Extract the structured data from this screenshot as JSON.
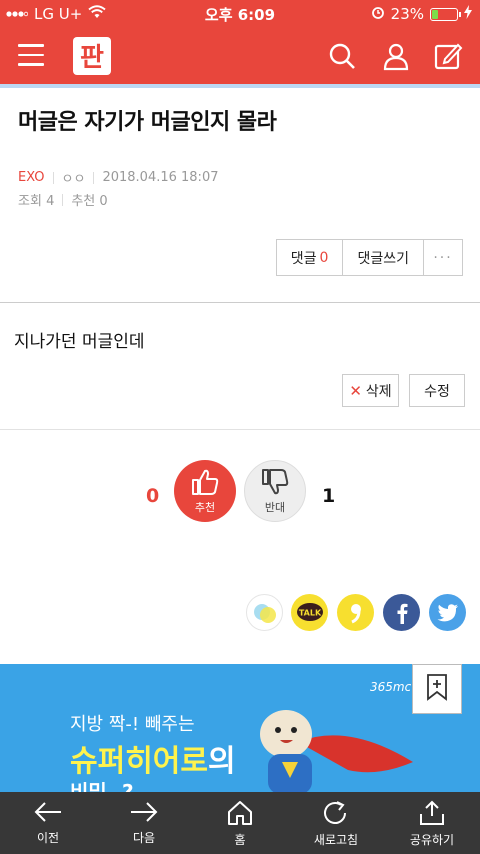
{
  "status_bar": {
    "carrier": "LG U+",
    "time": "오후 6:09",
    "battery": "23%",
    "battery_level": 0.23
  },
  "colors": {
    "brand": "#e8463c",
    "link_blue": "#3aa3e6",
    "toolbar": "#373737"
  },
  "header": {
    "icons": [
      "menu-icon",
      "pann-logo",
      "search-icon",
      "user-icon",
      "write-icon"
    ],
    "logo_text": "판"
  },
  "article": {
    "title": "머글은 자기가 머글인지 몰라",
    "author": "EXO",
    "nickname": "ㅇㅇ",
    "date": "2018.04.16 18:07",
    "views_label": "조회",
    "views": "4",
    "recommend_label": "추천",
    "recommend": "0"
  },
  "actions": {
    "comment_label": "댓글",
    "comment_count": "0",
    "write_comment": "댓글쓰기",
    "more": "···"
  },
  "comment": {
    "text": "지나가던 머글인데",
    "delete_label": "삭제",
    "edit_label": "수정"
  },
  "votes": {
    "up_count": "0",
    "up_label": "추천",
    "down_count": "1",
    "down_label": "반대"
  },
  "share": {
    "icons": [
      "chat-bubbles-icon",
      "kakaotalk-icon",
      "kakaostory-icon",
      "facebook-icon",
      "twitter-icon"
    ],
    "kakao_label": "TALK"
  },
  "banner": {
    "line1": "지방 짝-! 빼주는",
    "line2_main": "슈퍼히어로",
    "line2_suffix": "의",
    "line3": "비밀..?",
    "brand": "365mc"
  },
  "toolbar": {
    "items": [
      {
        "label": "이전",
        "icon": "arrow-left-icon"
      },
      {
        "label": "다음",
        "icon": "arrow-right-icon"
      },
      {
        "label": "홈",
        "icon": "home-icon"
      },
      {
        "label": "새로고침",
        "icon": "refresh-icon"
      },
      {
        "label": "공유하기",
        "icon": "share-icon"
      }
    ]
  }
}
